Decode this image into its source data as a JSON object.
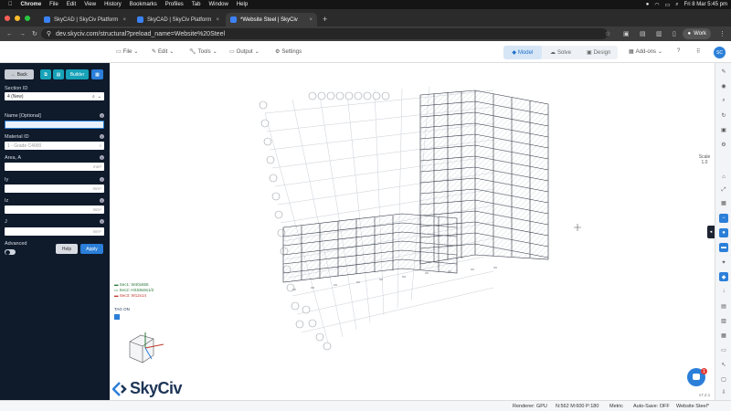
{
  "os_menu": {
    "apple": "",
    "items": [
      "Chrome",
      "File",
      "Edit",
      "View",
      "History",
      "Bookmarks",
      "Profiles",
      "Tab",
      "Window",
      "Help"
    ],
    "datetime": "Fri 8 Mar  5:45 pm"
  },
  "browser": {
    "tabs": [
      {
        "label": "SkyCAD | SkyCiv Platform",
        "active": false
      },
      {
        "label": "SkyCAD | SkyCiv Platform",
        "active": false
      },
      {
        "label": "*Website Steel | SkyCiv",
        "active": true
      }
    ],
    "new_tab": "+",
    "url": "dev.skyciv.com/structural?preload_name=Website%20Steel",
    "profile": "Work"
  },
  "app": {
    "menus": [
      "File",
      "Edit",
      "Tools",
      "Output",
      "Settings"
    ],
    "modes": [
      {
        "label": "Model",
        "active": true
      },
      {
        "label": "Solve",
        "active": false
      },
      {
        "label": "Design",
        "active": false
      }
    ],
    "addons": "Add-ons",
    "avatar": "SC"
  },
  "sidebar": {
    "back": "Back",
    "builder": "Builder",
    "section_id_label": "Section ID",
    "section_id_value": "4 (New)",
    "name_label": "Name [Optional]",
    "name_value": "",
    "material_label": "Material ID",
    "material_value": "1 - Grade C4000",
    "area_label": "Area, A",
    "area_unit": "mm²",
    "iy_label": "Iy",
    "iy_unit": "mm⁴",
    "iz_label": "Iz",
    "iz_unit": "mm⁴",
    "j_label": "J",
    "j_unit": "mm⁴",
    "advanced_label": "Advanced",
    "help": "Help",
    "apply": "Apply"
  },
  "legend": {
    "items": [
      {
        "label": "Sec1: W40x655",
        "color": "#2a7a3a"
      },
      {
        "label": "Sec2: HSS8x8x1/2",
        "color": "#2a7a3a"
      },
      {
        "label": "Sec3: W12x14",
        "color": "#c0392b"
      }
    ],
    "tag": "TAG ON"
  },
  "canvas": {
    "scale_label": "Scale",
    "scale_value": "1.0",
    "version": "v7.2.1"
  },
  "status": {
    "renderer": "Renderer: GPU",
    "counts": "N:562  M:600  P:180",
    "units": "Metric",
    "autosave": "Auto-Save: OFF",
    "project": "Website Steel*"
  },
  "logo": "SkyCiv",
  "colors": {
    "accent": "#2b7fd9",
    "sidebar": "#0f1a2b",
    "builder": "#17a2b8"
  }
}
